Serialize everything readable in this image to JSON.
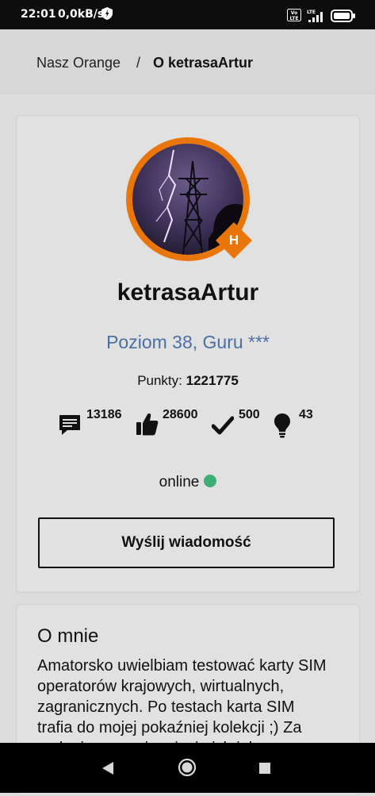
{
  "status_bar": {
    "time": "22:01",
    "speed": "0,0kB/s",
    "volte": "Vo LTE",
    "network": "LTE"
  },
  "breadcrumb": {
    "home": "Nasz Orange",
    "separator": "/",
    "current": "O ketrasaArtur"
  },
  "profile": {
    "rank_letter": "H",
    "username": "ketrasaArtur",
    "level": "Poziom 38, Guru ***",
    "points_label": "Punkty:",
    "points_value": "1221775",
    "stats": [
      {
        "icon": "comment-icon",
        "value": "13186"
      },
      {
        "icon": "thumbs-up-icon",
        "value": "28600"
      },
      {
        "icon": "checkmark-icon",
        "value": "500"
      },
      {
        "icon": "lightbulb-icon",
        "value": "43"
      }
    ],
    "status": "online",
    "send_message_label": "Wyślij wiadomość"
  },
  "about": {
    "title": "O mnie",
    "text": "Amatorsko uwielbiam testować karty SIM operatorów krajowych, wirtualnych, zagranicznych. Po testach karta SIM trafia do mojej pokaźniej kolekcji ;) Za zadanie mam ciągnięcie ich jak"
  },
  "colors": {
    "accent_orange": "#e8760b",
    "level_blue": "#4a6fa5",
    "online_green": "#3fae72"
  }
}
